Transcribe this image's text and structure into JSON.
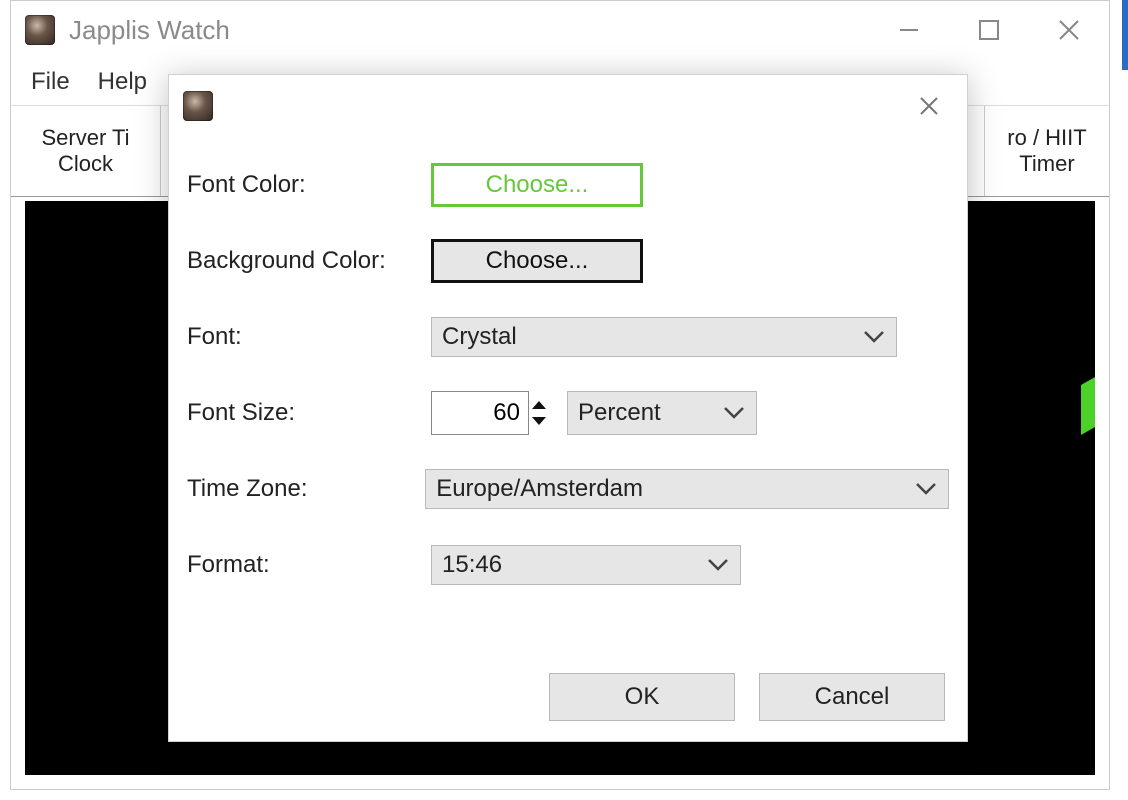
{
  "window": {
    "title": "Japplis Watch"
  },
  "menu": {
    "file": "File",
    "help": "Help"
  },
  "tabs": {
    "left_line1": "Server Ti",
    "left_line2": "Clock",
    "right_line1": "ro / HIIT",
    "right_line2": "Timer"
  },
  "dialog": {
    "labels": {
      "font_color": "Font Color:",
      "bg_color": "Background Color:",
      "font": "Font:",
      "font_size": "Font Size:",
      "time_zone": "Time Zone:",
      "format": "Format:"
    },
    "choose_label": "Choose...",
    "font_value": "Crystal",
    "font_size_value": "60",
    "font_size_unit": "Percent",
    "time_zone_value": "Europe/Amsterdam",
    "format_value": "15:46",
    "ok_label": "OK",
    "cancel_label": "Cancel"
  }
}
